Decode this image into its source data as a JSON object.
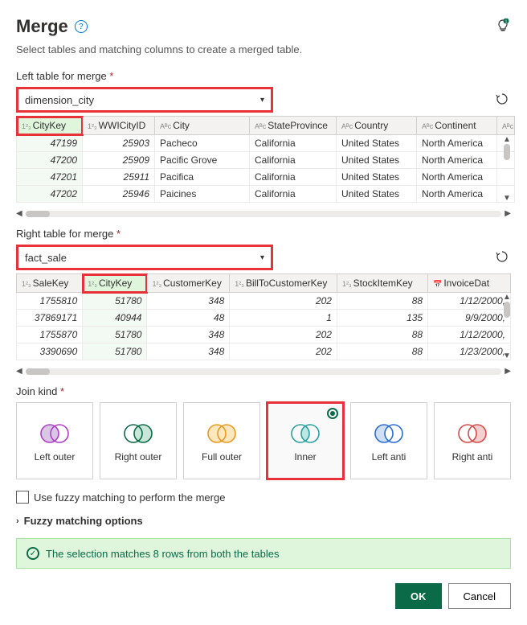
{
  "header": {
    "title": "Merge",
    "subtitle": "Select tables and matching columns to create a merged table."
  },
  "left": {
    "label": "Left table for merge",
    "value": "dimension_city",
    "columns": [
      "CityKey",
      "WWICityID",
      "City",
      "StateProvince",
      "Country",
      "Continent"
    ],
    "rows": [
      [
        "47199",
        "25903",
        "Pacheco",
        "California",
        "United States",
        "North America"
      ],
      [
        "47200",
        "25909",
        "Pacific Grove",
        "California",
        "United States",
        "North America"
      ],
      [
        "47201",
        "25911",
        "Pacifica",
        "California",
        "United States",
        "North America"
      ],
      [
        "47202",
        "25946",
        "Paicines",
        "California",
        "United States",
        "North America"
      ]
    ]
  },
  "right": {
    "label": "Right table for merge",
    "value": "fact_sale",
    "columns": [
      "SaleKey",
      "CityKey",
      "CustomerKey",
      "BillToCustomerKey",
      "StockItemKey",
      "InvoiceDat"
    ],
    "rows": [
      [
        "1755810",
        "51780",
        "348",
        "202",
        "88",
        "1/12/2000,"
      ],
      [
        "37869171",
        "40944",
        "48",
        "1",
        "135",
        "9/9/2000,"
      ],
      [
        "1755870",
        "51780",
        "348",
        "202",
        "88",
        "1/12/2000,"
      ],
      [
        "3390690",
        "51780",
        "348",
        "202",
        "88",
        "1/23/2000,"
      ]
    ]
  },
  "join": {
    "label": "Join kind",
    "options": [
      "Left outer",
      "Right outer",
      "Full outer",
      "Inner",
      "Left anti",
      "Right anti"
    ],
    "selected": "Inner",
    "fuzzy_label": "Use fuzzy matching to perform the merge",
    "expander": "Fuzzy matching options"
  },
  "status": {
    "message": "The selection matches 8 rows from both the tables"
  },
  "footer": {
    "ok": "OK",
    "cancel": "Cancel"
  }
}
